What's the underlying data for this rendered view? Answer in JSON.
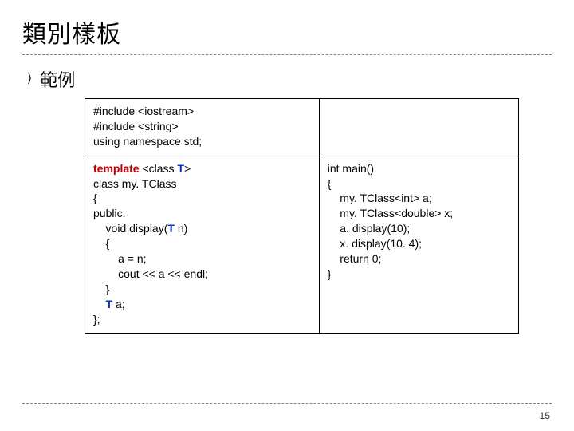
{
  "slide": {
    "title": "類別樣板",
    "bullet": "範例",
    "page_number": "15"
  },
  "code": {
    "top_left": {
      "l1": "#include <iostream>",
      "l2": "#include <string>",
      "l3": "using namespace std;"
    },
    "bottom_left": {
      "l1a": "template",
      "l1b": " <class ",
      "l1c": "T",
      "l1d": ">",
      "l2": "class my. TClass",
      "l3": "{",
      "l4": "public:",
      "l5a": "    void display(",
      "l5b": "T",
      "l5c": " n)",
      "l6": "    {",
      "l7": "        a = n;",
      "l8": "        cout << a << endl;",
      "l9": "    }",
      "l10a": "    ",
      "l10b": "T",
      "l10c": " a;",
      "l11": "};"
    },
    "bottom_right": {
      "l1": "int main()",
      "l2": "{",
      "l3": "    my. TClass<int> a;",
      "l4": "    my. TClass<double> x;",
      "l5": "    a. display(10);",
      "l6": "    x. display(10. 4);",
      "l7": "    return 0;",
      "l8": "}"
    }
  }
}
